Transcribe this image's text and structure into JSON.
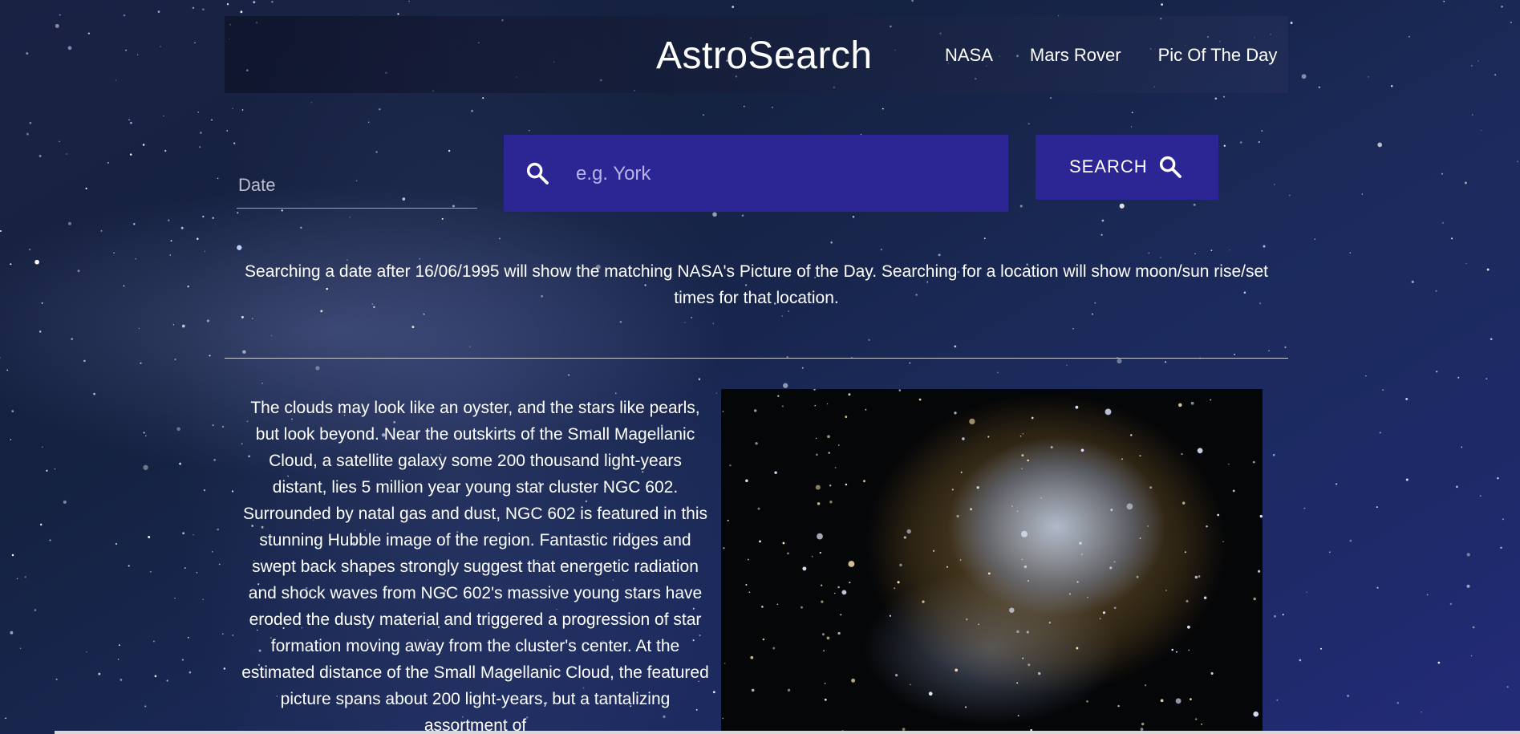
{
  "header": {
    "brand": "AstroSearch",
    "nav": [
      "NASA",
      "Mars Rover",
      "Pic Of The Day"
    ]
  },
  "search": {
    "date_placeholder": "Date",
    "location_placeholder": "e.g. York",
    "button_label": "SEARCH"
  },
  "info_text": "Searching a date after 16/06/1995 will show the matching NASA's Picture of the Day. Searching for a location will show moon/sun rise/set times for that location.",
  "apod": {
    "explanation": "The clouds may look like an oyster, and the stars like pearls, but look beyond. Near the outskirts of the Small Magellanic Cloud, a satellite galaxy some 200 thousand light-years distant, lies 5 million year young star cluster NGC 602. Surrounded by natal gas and dust, NGC 602 is featured in this stunning Hubble image of the region. Fantastic ridges and swept back shapes strongly suggest that energetic radiation and shock waves from NGC 602's massive young stars have eroded the dusty material and triggered a progression of star formation moving away from the cluster's center. At the estimated distance of the Small Magellanic Cloud, the featured picture spans about 200 light-years, but a tantalizing assortment of"
  },
  "colors": {
    "accent": "#2c2594",
    "background": "#1b2650"
  }
}
